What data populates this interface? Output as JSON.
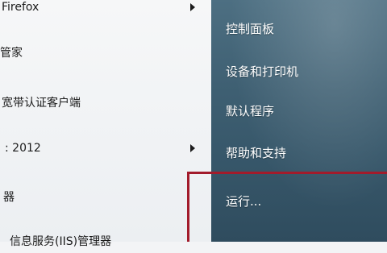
{
  "left_menu": {
    "items": [
      {
        "label": "Firefox",
        "has_submenu": true
      },
      {
        "label": "管家",
        "has_submenu": false
      },
      {
        "label": "宽带认证客户端",
        "has_submenu": false
      },
      {
        "label": ": 2012",
        "has_submenu": true
      },
      {
        "label": "器",
        "has_submenu": false
      },
      {
        "label": "信息服务(IIS)管理器",
        "has_submenu": false
      }
    ]
  },
  "right_menu": {
    "items": [
      {
        "label": "控制面板"
      },
      {
        "label": "设备和打印机"
      },
      {
        "label": "默认程序"
      },
      {
        "label": "帮助和支持"
      },
      {
        "label": "运行..."
      }
    ]
  },
  "colors": {
    "right_panel_top": "#4d6f82",
    "right_panel_bottom": "#2f4c5e",
    "annotation": "#a21b2b"
  }
}
